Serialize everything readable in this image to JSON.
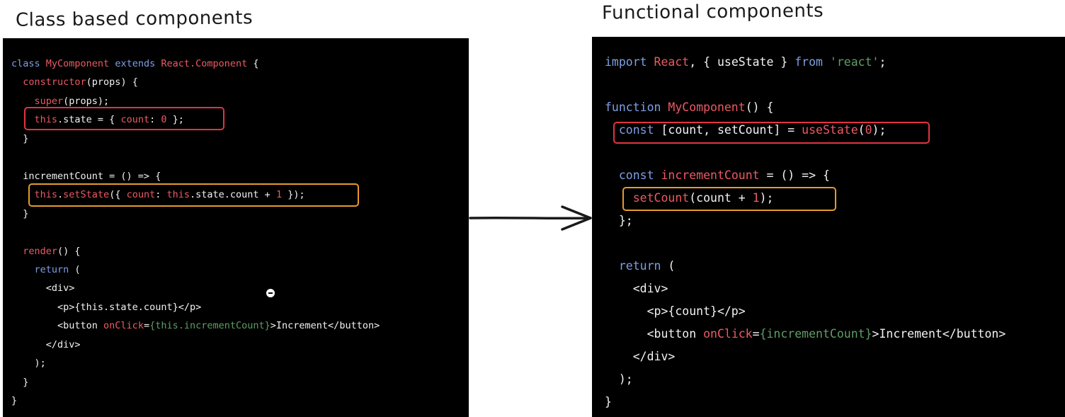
{
  "headings": {
    "left": "Class based components",
    "right": "Functional components"
  },
  "left_code": [
    [
      [
        "kw",
        "class "
      ],
      [
        "nm",
        "MyComponent "
      ],
      [
        "kw",
        "extends "
      ],
      [
        "nm",
        "React.Component"
      ],
      [
        "pl",
        " {"
      ]
    ],
    [
      [
        "pl",
        "  "
      ],
      [
        "nm",
        "constructor"
      ],
      [
        "pl",
        "(props) {"
      ]
    ],
    [
      [
        "pl",
        "    "
      ],
      [
        "nm",
        "super"
      ],
      [
        "pl",
        "(props);"
      ]
    ],
    [
      [
        "pl",
        "    "
      ],
      [
        "nm",
        "this"
      ],
      [
        "pl",
        ".state = { "
      ],
      [
        "nm",
        "count"
      ],
      [
        "pl",
        ": "
      ],
      [
        "nm",
        "0"
      ],
      [
        "pl",
        " };"
      ]
    ],
    [
      [
        "pl",
        "  }"
      ]
    ],
    [],
    [
      [
        "pl",
        "  incrementCount = () => {"
      ]
    ],
    [
      [
        "pl",
        "    "
      ],
      [
        "nm",
        "this"
      ],
      [
        "pl",
        "."
      ],
      [
        "nm",
        "setState"
      ],
      [
        "pl",
        "({ "
      ],
      [
        "nm",
        "count"
      ],
      [
        "pl",
        ": "
      ],
      [
        "nm",
        "this"
      ],
      [
        "pl",
        ".state.count + "
      ],
      [
        "nm",
        "1"
      ],
      [
        "pl",
        " });"
      ]
    ],
    [
      [
        "pl",
        "  }"
      ]
    ],
    [],
    [
      [
        "pl",
        "  "
      ],
      [
        "nm",
        "render"
      ],
      [
        "pl",
        "() {"
      ]
    ],
    [
      [
        "pl",
        "    "
      ],
      [
        "kw",
        "return"
      ],
      [
        "pl",
        " ("
      ]
    ],
    [
      [
        "pl",
        "      <div>"
      ]
    ],
    [
      [
        "pl",
        "        <p>{this.state.count}</p>"
      ]
    ],
    [
      [
        "pl",
        "        <button "
      ],
      [
        "nm",
        "onClick"
      ],
      [
        "pl",
        "="
      ],
      [
        "st",
        "{this.incrementCount}"
      ],
      [
        "pl",
        ">Increment</button>"
      ]
    ],
    [
      [
        "pl",
        "      </div>"
      ]
    ],
    [
      [
        "pl",
        "    );"
      ]
    ],
    [
      [
        "pl",
        "  }"
      ]
    ],
    [
      [
        "pl",
        "}"
      ]
    ]
  ],
  "right_code": [
    [
      [
        "kw",
        "import "
      ],
      [
        "nm",
        "React"
      ],
      [
        "pl",
        ", { useState } "
      ],
      [
        "kw",
        "from "
      ],
      [
        "st",
        "'react'"
      ],
      [
        "pl",
        ";"
      ]
    ],
    [],
    [
      [
        "kw",
        "function "
      ],
      [
        "nm",
        "MyComponent"
      ],
      [
        "pl",
        "() {"
      ]
    ],
    [
      [
        "pl",
        "  "
      ],
      [
        "kw",
        "const"
      ],
      [
        "pl",
        " [count, setCount] = "
      ],
      [
        "nm",
        "useState"
      ],
      [
        "pl",
        "("
      ],
      [
        "nm",
        "0"
      ],
      [
        "pl",
        ");"
      ]
    ],
    [],
    [
      [
        "pl",
        "  "
      ],
      [
        "kw",
        "const "
      ],
      [
        "nm",
        "incrementCount"
      ],
      [
        "pl",
        " = () => {"
      ]
    ],
    [
      [
        "pl",
        "    "
      ],
      [
        "nm",
        "setCount"
      ],
      [
        "pl",
        "(count + "
      ],
      [
        "nm",
        "1"
      ],
      [
        "pl",
        ");"
      ]
    ],
    [
      [
        "pl",
        "  };"
      ]
    ],
    [],
    [
      [
        "pl",
        "  "
      ],
      [
        "kw",
        "return"
      ],
      [
        "pl",
        " ("
      ]
    ],
    [
      [
        "pl",
        "    <div>"
      ]
    ],
    [
      [
        "pl",
        "      <p>{count}</p>"
      ]
    ],
    [
      [
        "pl",
        "      <button "
      ],
      [
        "nm",
        "onClick"
      ],
      [
        "pl",
        "="
      ],
      [
        "st",
        "{incrementCount}"
      ],
      [
        "pl",
        ">Increment</button>"
      ]
    ],
    [
      [
        "pl",
        "    </div>"
      ]
    ],
    [
      [
        "pl",
        "  );"
      ]
    ],
    [
      [
        "pl",
        "}"
      ]
    ]
  ],
  "colors": {
    "background": "#ffffff",
    "panel": "#000000",
    "keyword": "#7f9fe6",
    "name": "#ec5a63",
    "string": "#5f9e67",
    "plain": "#f2f2f2",
    "highlight_red": "#e2343f",
    "highlight_orange": "#e69a2c",
    "arrow": "#1a1a1a"
  },
  "icons": {
    "arrow": "right-arrow-icon",
    "cursor": "cursor-icon"
  }
}
